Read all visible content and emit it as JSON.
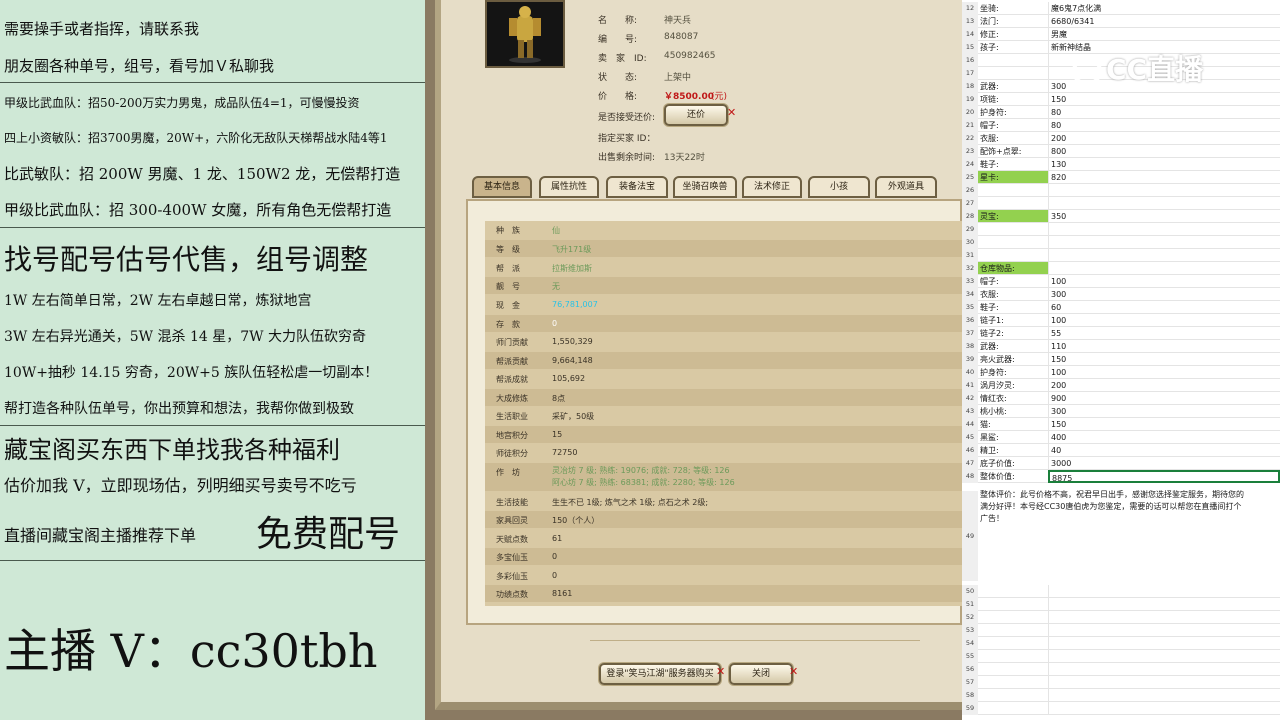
{
  "promo": {
    "l1": "需要操手或者指挥，请联系我",
    "l2": "朋友圈各种单号，组号，看号加Ｖ私聊我",
    "l3": "甲级比武血队：招50-200万实力男鬼，成品队伍4=1，可慢慢投资",
    "l4": "四上小资敏队：招3700男魔，20W+，六阶化无敌队天梯帮战水陆4等1",
    "l5": "比武敏队：招 200W 男魔、1 龙、150W2 龙，无偿帮打造",
    "l6": "甲级比武血队：招 300-400W 女魔，所有角色无偿帮打造",
    "l7": "找号配号估号代售，组号调整",
    "l8": "1W 左右简单日常，2W 左右卓越日常，炼狱地宫",
    "l9": "3W 左右异光通关，5W 混杀 14 星，7W 大力队伍砍穷奇",
    "l10": "10W+抽秒 14.15 穷奇，20W+5 族队伍轻松虐一切副本！",
    "l11": "帮打造各种队伍单号，你出预算和想法，我帮你做到极致",
    "l12": "藏宝阁买东西下单找我各种福利",
    "l13": "估价加我 V，立即现场估，列明细买号卖号不吃亏",
    "l14a": "直播间藏宝阁主播推荐下单",
    "l14b": "免费配号",
    "l15": "主播 V：cc30tbh"
  },
  "listing": {
    "name_label": "名　　称:",
    "name_value": "神天兵",
    "id_label": "编　　号:",
    "id_value": "848087",
    "seller_label": "卖　家　ID:",
    "seller_value": "450982465",
    "status_label": "状　　态:",
    "status_value": "上架中",
    "price_label": "价　　格:",
    "price_value": "￥8500.00",
    "price_unit": "(元)",
    "bargain_label": "是否接受还价:",
    "bargain_button": "还价",
    "buyer_label": "指定买家 ID：",
    "time_label": "出售剩余时间:",
    "time_value": "13天22时"
  },
  "tabs": [
    "基本信息",
    "属性抗性",
    "装备法宝",
    "坐骑召唤兽",
    "法术修正",
    "小孩",
    "外观道具"
  ],
  "stats": [
    {
      "label": "种　族",
      "value": "仙",
      "style": "green"
    },
    {
      "label": "等　级",
      "value": "飞升171级",
      "style": "green"
    },
    {
      "label": "帮　派",
      "value": "拉斯维加斯",
      "style": "green"
    },
    {
      "label": "靓　号",
      "value": "无",
      "style": "green"
    },
    {
      "label": "现　金",
      "value": "76,781,007",
      "style": "cyan"
    },
    {
      "label": "存　款",
      "value": "0",
      "style": "white"
    },
    {
      "label": "师门贡献",
      "value": "1,550,329",
      "style": ""
    },
    {
      "label": "帮派贡献",
      "value": "9,664,148",
      "style": ""
    },
    {
      "label": "帮派成就",
      "value": "105,692",
      "style": ""
    },
    {
      "label": "大成修炼",
      "value": "8点",
      "style": ""
    },
    {
      "label": "生活职业",
      "value": "采矿，50级",
      "style": ""
    },
    {
      "label": "地宫积分",
      "value": "15",
      "style": ""
    },
    {
      "label": "师徒积分",
      "value": "72750",
      "style": ""
    },
    {
      "label": "作　坊",
      "value": "",
      "style": ""
    },
    {
      "label": "生活技能",
      "value": "生生不已 1级; 炼气之术 1级; 点石之术 2级;",
      "style": ""
    },
    {
      "label": "家具回灵",
      "value": "150（个人）",
      "style": ""
    },
    {
      "label": "天赋点数",
      "value": "61",
      "style": ""
    },
    {
      "label": "多宝仙玉",
      "value": "0",
      "style": ""
    },
    {
      "label": "多彩仙玉",
      "value": "0",
      "style": ""
    },
    {
      "label": "功绩点数",
      "value": "8161",
      "style": ""
    }
  ],
  "workshop": {
    "line1": "灵冶坊 7 级; 熟练: 19076; 成就: 728; 等级: 126",
    "line2": "阿心坊 7 级; 熟练: 68381; 成就: 2280; 等级: 126"
  },
  "footer": {
    "login_button": "登录\"笑马江湖\"服务器购买",
    "close_button": "关闭"
  },
  "sheet": {
    "rows": [
      {
        "n": "12",
        "a": "坐骑:",
        "b": "魔6鬼7点化满"
      },
      {
        "n": "13",
        "a": "法门:",
        "b": "6680/6341"
      },
      {
        "n": "14",
        "a": "修正:",
        "b": "男魔"
      },
      {
        "n": "15",
        "a": "孩子:",
        "b": "新新神结晶"
      },
      {
        "n": "16",
        "a": "",
        "b": ""
      },
      {
        "n": "17",
        "a": "",
        "b": ""
      },
      {
        "n": "18",
        "a": "武器:",
        "b": "300"
      },
      {
        "n": "19",
        "a": "项链:",
        "b": "150"
      },
      {
        "n": "20",
        "a": "护身符:",
        "b": "80"
      },
      {
        "n": "21",
        "a": "帽子:",
        "b": "80"
      },
      {
        "n": "22",
        "a": "衣服:",
        "b": "200"
      },
      {
        "n": "23",
        "a": "配饰+点翠:",
        "b": "800"
      },
      {
        "n": "24",
        "a": "鞋子:",
        "b": "130"
      },
      {
        "n": "25",
        "a": "星卡:",
        "b": "820",
        "green": true
      },
      {
        "n": "26",
        "a": "",
        "b": ""
      },
      {
        "n": "27",
        "a": "",
        "b": ""
      },
      {
        "n": "28",
        "a": "灵宝:",
        "b": "350",
        "green": true
      },
      {
        "n": "29",
        "a": "",
        "b": ""
      },
      {
        "n": "30",
        "a": "",
        "b": ""
      },
      {
        "n": "31",
        "a": "",
        "b": ""
      },
      {
        "n": "32",
        "a": "仓库物品:",
        "b": "",
        "green": true
      },
      {
        "n": "33",
        "a": "帽子:",
        "b": "100"
      },
      {
        "n": "34",
        "a": "衣服:",
        "b": "300"
      },
      {
        "n": "35",
        "a": "鞋子:",
        "b": "60"
      },
      {
        "n": "36",
        "a": "链子1:",
        "b": "100"
      },
      {
        "n": "37",
        "a": "链子2:",
        "b": "55"
      },
      {
        "n": "38",
        "a": "武器:",
        "b": "110"
      },
      {
        "n": "39",
        "a": "亮火武器:",
        "b": "150"
      },
      {
        "n": "40",
        "a": "护身符:",
        "b": "100"
      },
      {
        "n": "41",
        "a": "涡月汐灵:",
        "b": "200"
      },
      {
        "n": "42",
        "a": "情红衣:",
        "b": "900"
      },
      {
        "n": "43",
        "a": "桃小桃:",
        "b": "300"
      },
      {
        "n": "44",
        "a": "猫:",
        "b": "150"
      },
      {
        "n": "45",
        "a": "黑鲨:",
        "b": "400"
      },
      {
        "n": "46",
        "a": "精卫:",
        "b": "40"
      },
      {
        "n": "47",
        "a": "底子价值:",
        "b": "3000"
      },
      {
        "n": "48",
        "a": "整体价值:",
        "b": "8875",
        "selected": true
      }
    ],
    "comment": "整体评价：此号价格不高，祝君早日出手，感谢您选择鉴定服务，期待您的",
    "comment2": "满分好评！本号经CC30唐伯虎为您鉴定，需要的话可以帮您在直播间打个",
    "comment3": "广告！",
    "rows_after": [
      "50",
      "51",
      "52",
      "53",
      "54",
      "55",
      "56",
      "57",
      "58",
      "59"
    ],
    "logo": "CC直播"
  }
}
